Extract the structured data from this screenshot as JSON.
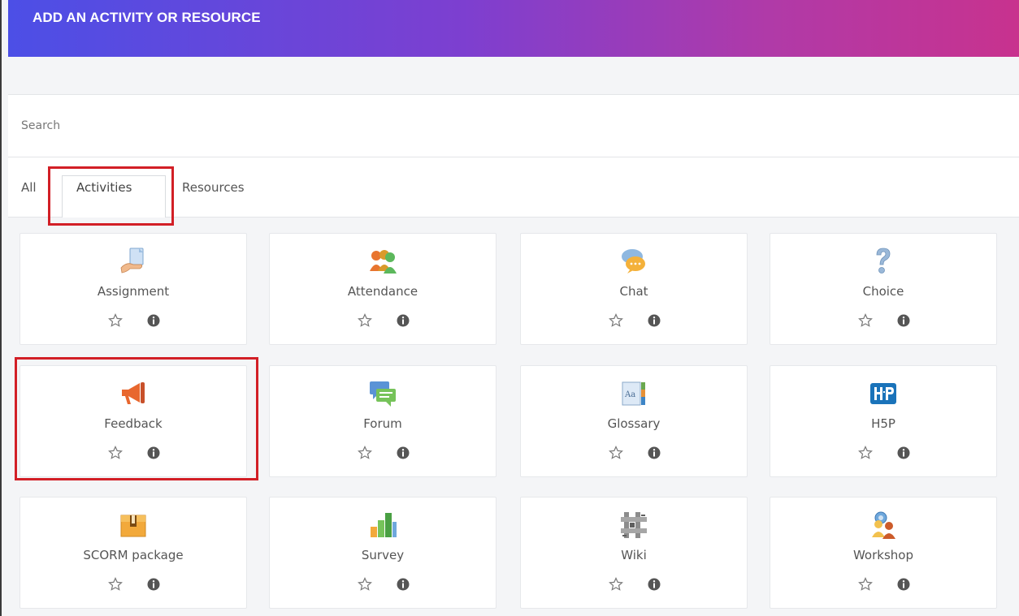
{
  "header": {
    "title": "ADD AN ACTIVITY OR RESOURCE"
  },
  "search": {
    "placeholder": "Search",
    "value": ""
  },
  "tabs": [
    {
      "label": "All"
    },
    {
      "label": "Activities",
      "active": true
    },
    {
      "label": "Resources"
    }
  ],
  "modules": [
    {
      "name": "Assignment",
      "icon": "assignment-icon"
    },
    {
      "name": "Attendance",
      "icon": "attendance-icon"
    },
    {
      "name": "Chat",
      "icon": "chat-icon"
    },
    {
      "name": "Choice",
      "icon": "choice-icon"
    },
    {
      "name": "Feedback",
      "icon": "feedback-icon"
    },
    {
      "name": "Forum",
      "icon": "forum-icon"
    },
    {
      "name": "Glossary",
      "icon": "glossary-icon"
    },
    {
      "name": "H5P",
      "icon": "h5p-icon"
    },
    {
      "name": "SCORM package",
      "icon": "scorm-icon"
    },
    {
      "name": "Survey",
      "icon": "survey-icon"
    },
    {
      "name": "Wiki",
      "icon": "wiki-icon"
    },
    {
      "name": "Workshop",
      "icon": "workshop-icon"
    }
  ],
  "colors": {
    "header_gradient_start": "#4c4fe6",
    "header_gradient_end": "#c8328e",
    "highlight": "#d21f26"
  }
}
